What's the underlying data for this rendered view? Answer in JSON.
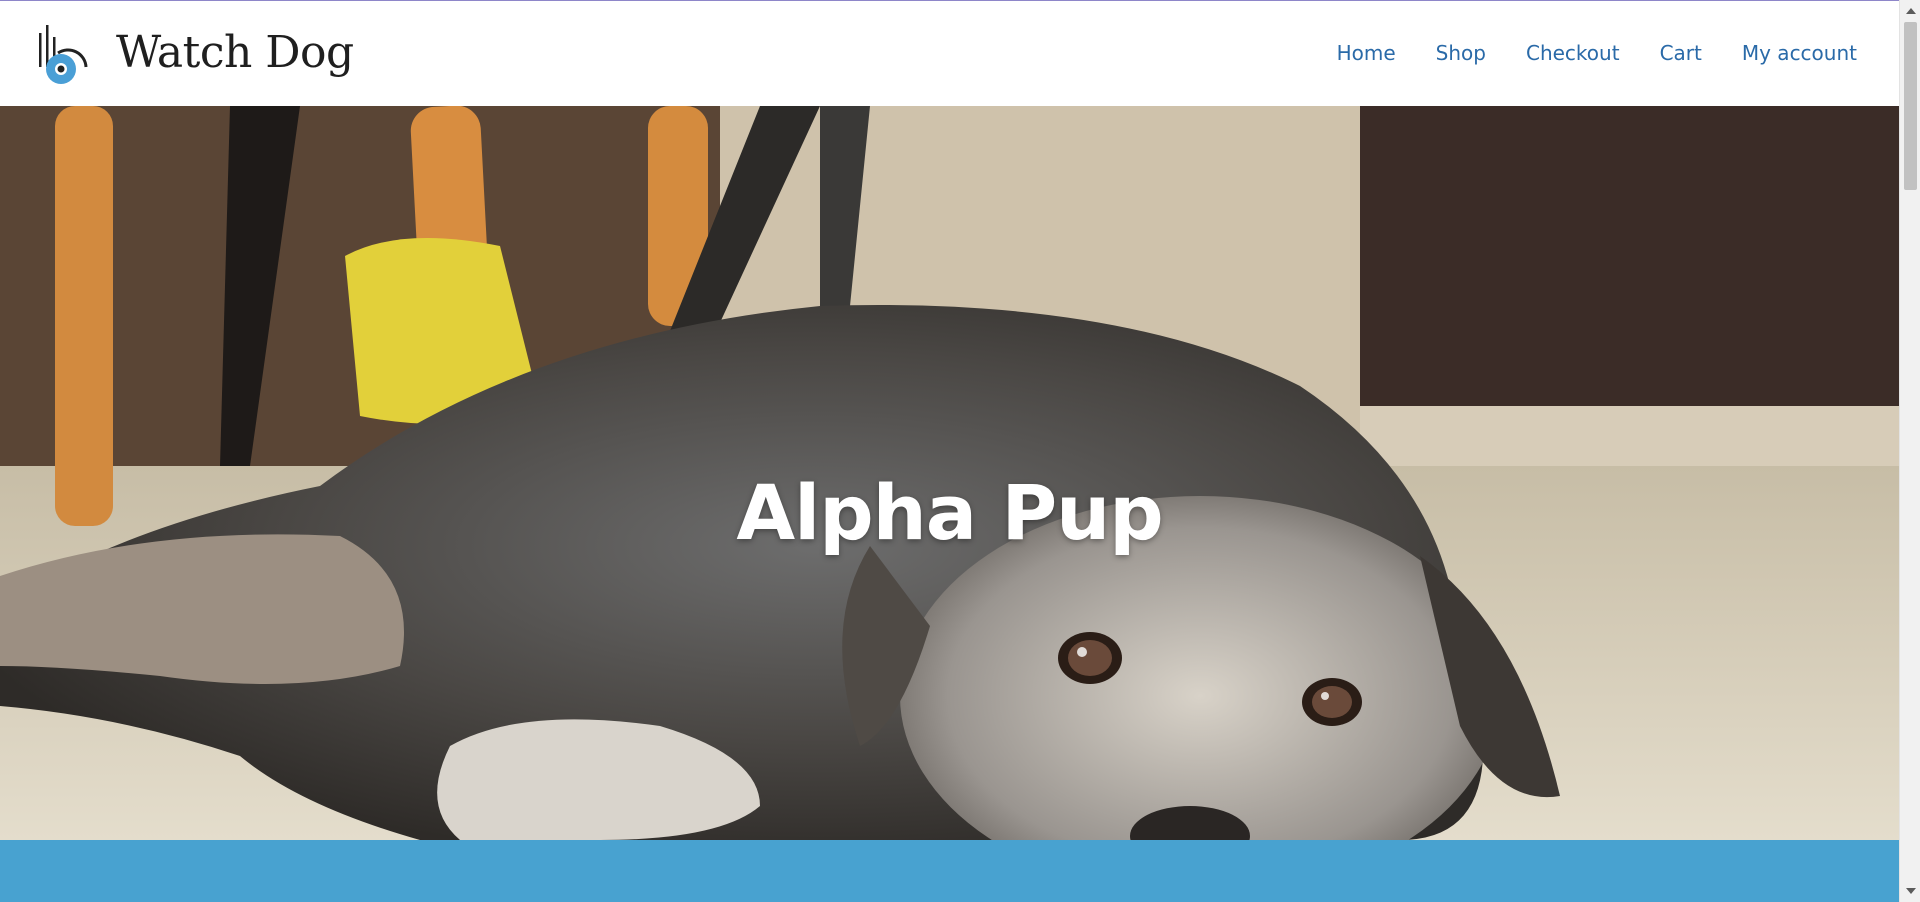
{
  "site": {
    "title": "Watch Dog",
    "logo_icon": "watch-dog-logo-icon"
  },
  "nav": {
    "items": [
      {
        "label": "Home"
      },
      {
        "label": "Shop"
      },
      {
        "label": "Checkout"
      },
      {
        "label": "Cart"
      },
      {
        "label": "My account"
      }
    ]
  },
  "hero": {
    "title": "Alpha Pup",
    "image": "dog-lying-on-floor-photo"
  },
  "colors": {
    "nav_link": "#2a6aa8",
    "band": "#48a2d0",
    "logo_blue": "#4a9fd6"
  }
}
